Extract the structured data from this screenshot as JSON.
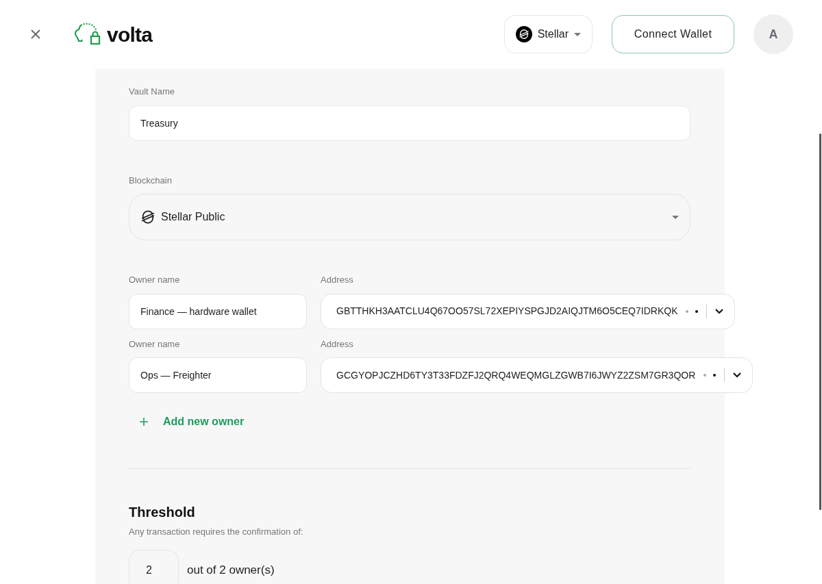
{
  "header": {
    "brand": "volta",
    "network": "Stellar",
    "connect_button": "Connect Wallet",
    "avatar": "A"
  },
  "form": {
    "vault_name": {
      "label": "Vault Name",
      "value": "Treasury"
    },
    "blockchain": {
      "label": "Blockchain",
      "value": "Stellar Public"
    },
    "owners": [
      {
        "name_label": "Owner name",
        "name": "Finance — hardware wallet",
        "address_label": "Address",
        "address": "GBTTHKH3AATCLU4Q67OO57SL72XEPIYSPGJD2AIQJTM6O5CEQ7IDRKQK"
      },
      {
        "name_label": "Owner name",
        "name": "Ops — Freighter",
        "address_label": "Address",
        "address": "GCGYOPJCZHD6TY3T33FDZFJ2QRQ4WEQMGLZGWB7I6JWYZ2ZSM7GR3QOR"
      }
    ],
    "add_owner": "Add new owner",
    "threshold": {
      "title": "Threshold",
      "subtitle": "Any transaction requires the confirmation of:",
      "value": "2",
      "suffix": "out of 2 owner(s)"
    }
  }
}
